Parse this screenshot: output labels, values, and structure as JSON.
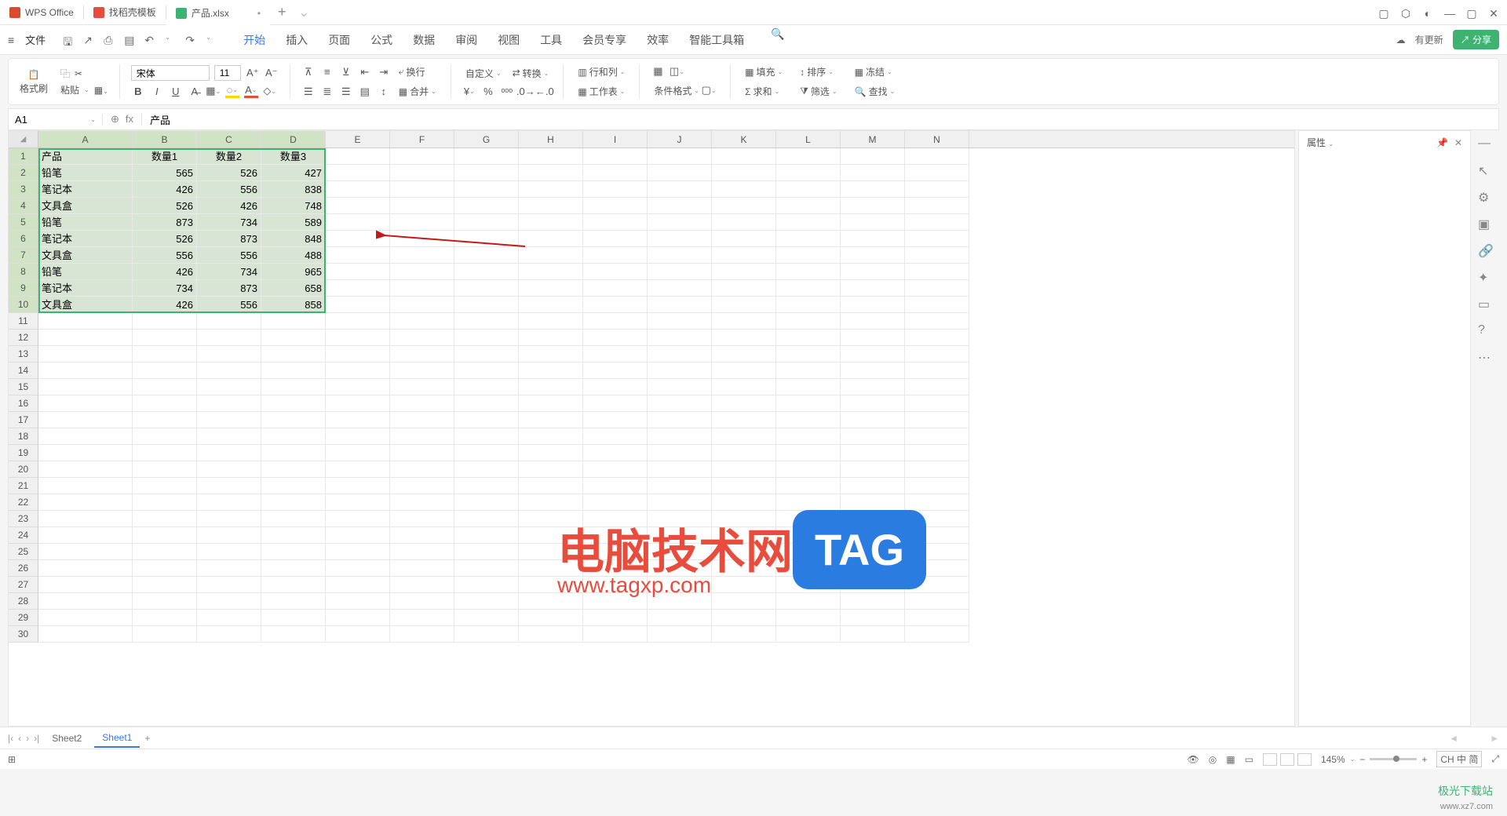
{
  "tabs": {
    "wps": "WPS Office",
    "template": "找稻壳模板",
    "file": "产品.xlsx"
  },
  "menu": {
    "file": "文件",
    "nav": [
      "开始",
      "插入",
      "页面",
      "公式",
      "数据",
      "审阅",
      "视图",
      "工具",
      "会员专享",
      "效率",
      "智能工具箱"
    ],
    "update": "有更新",
    "share": "分享"
  },
  "ribbon": {
    "format_painter": "格式刷",
    "paste": "粘贴",
    "font": "宋体",
    "font_size": "11",
    "wrap": "换行",
    "custom": "自定义",
    "convert": "转换",
    "row_col": "行和列",
    "worksheet": "工作表",
    "cond_format": "条件格式",
    "fill": "填充",
    "sort": "排序",
    "freeze": "冻结",
    "sum": "求和",
    "filter": "筛选",
    "find": "查找",
    "merge": "合并"
  },
  "formula": {
    "cell_ref": "A1",
    "fx": "fx",
    "value": "产品"
  },
  "properties": "属性",
  "columns": [
    "A",
    "B",
    "C",
    "D",
    "E",
    "F",
    "G",
    "H",
    "I",
    "J",
    "K",
    "L",
    "M",
    "N"
  ],
  "headers": [
    "产品",
    "数量1",
    "数量2",
    "数量3"
  ],
  "data": [
    [
      "铅笔",
      "565",
      "526",
      "427"
    ],
    [
      "笔记本",
      "426",
      "556",
      "838"
    ],
    [
      "文具盒",
      "526",
      "426",
      "748"
    ],
    [
      "铅笔",
      "873",
      "734",
      "589"
    ],
    [
      "笔记本",
      "526",
      "873",
      "848"
    ],
    [
      "文具盒",
      "556",
      "556",
      "488"
    ],
    [
      "铅笔",
      "426",
      "734",
      "965"
    ],
    [
      "笔记本",
      "734",
      "873",
      "658"
    ],
    [
      "文具盒",
      "426",
      "556",
      "858"
    ]
  ],
  "sheets": {
    "sheet2": "Sheet2",
    "sheet1": "Sheet1"
  },
  "status": {
    "zoom": "145%",
    "ime": "CH 中 简"
  },
  "watermark": {
    "title": "电脑技术网",
    "url": "www.tagxp.com",
    "tag": "TAG",
    "brand1": "极光下载站",
    "brand2": "www.xz7.com"
  }
}
